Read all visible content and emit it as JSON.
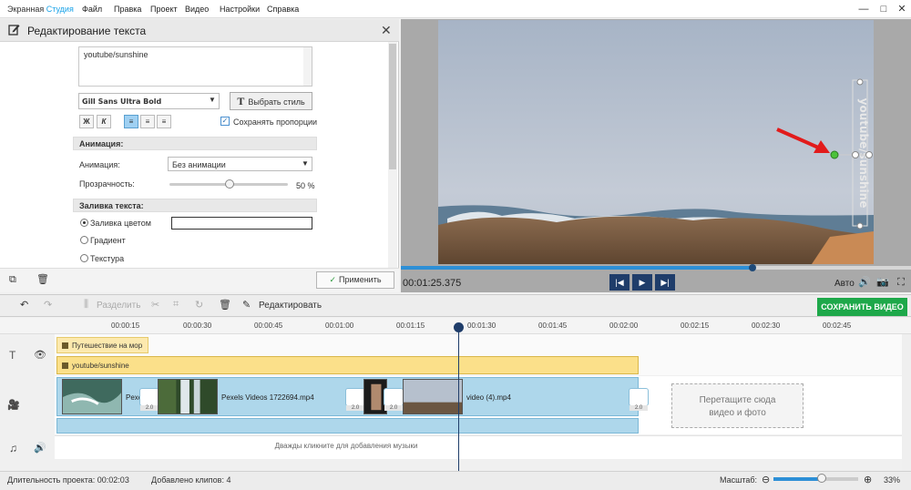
{
  "app": {
    "title_part1": "Экранная ",
    "title_part2": "Студия"
  },
  "menu": [
    "Файл",
    "Правка",
    "Проект",
    "Видео",
    "Настройки",
    "Справка"
  ],
  "window_controls": {
    "minimize": "—",
    "maximize": "□",
    "close": "✕"
  },
  "panel": {
    "title": "Редактирование текста",
    "text_value": "youtube/sunshine",
    "font": "Gill Sans Ultra Bold",
    "style_button": "Выбрать стиль",
    "format_buttons": [
      "Ж",
      "К"
    ],
    "keep_proportions": "Сохранять пропорции",
    "animation_section": "Анимация:",
    "animation_label": "Анимация:",
    "animation_value": "Без анимации",
    "opacity_label": "Прозрачность:",
    "opacity_value": "50 %",
    "opacity_level": 0.5,
    "fill_section": "Заливка текста:",
    "fill_options": [
      "Заливка цветом",
      "Градиент",
      "Текстура"
    ],
    "fill_selected": "Заливка цветом",
    "apply_button": "Применить"
  },
  "preview": {
    "timecode": "00:01:25.375",
    "progress_fraction": 0.69,
    "overlay_text": "youtube/sunshine",
    "auto_label": "Авто"
  },
  "toolbar": {
    "split": "Разделить",
    "edit": "Редактировать",
    "save_video": "СОХРАНИТЬ ВИДЕО"
  },
  "timeline": {
    "ticks": [
      "00:00:15",
      "00:00:30",
      "00:00:45",
      "00:01:00",
      "00:01:15",
      "00:01:30",
      "00:01:45",
      "00:02:00",
      "00:02:15",
      "00:02:30",
      "00:02:45"
    ],
    "text_clips": [
      "Путешествие на мор",
      "youtube/sunshine"
    ],
    "video_clips": [
      "Pexe",
      "Pexels Videos 1722694.mp4",
      "video (4).mp4"
    ],
    "transition_duration": "2.0",
    "dropzone_text": "Перетащите сюда\nвидео и фото",
    "music_hint": "Дважды кликните для добавления музыки"
  },
  "status": {
    "duration_label": "Длительность проекта: 00:02:03",
    "clips_label": "Добавлено клипов: 4",
    "zoom_label": "Масштаб:",
    "zoom_value": "33%",
    "zoom_level": 0.33
  },
  "colors": {
    "accent": "#1aa3e8",
    "save": "#1ea84a",
    "playhead": "#1f3d6a",
    "text_clip": "#fbe08a",
    "video_clip": "#aed7eb"
  }
}
